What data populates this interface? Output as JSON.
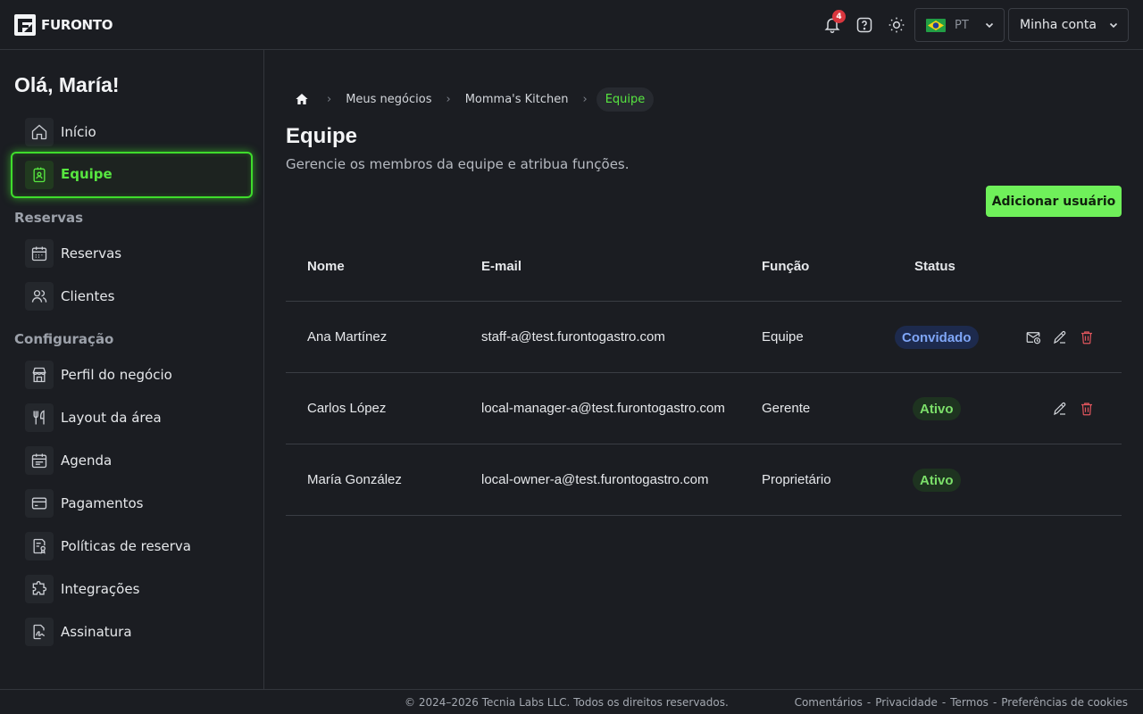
{
  "brand": {
    "name": "FURONTO"
  },
  "topbar": {
    "notifications_count": "4",
    "language": "PT",
    "account_label": "Minha conta"
  },
  "sidebar": {
    "greeting": "Olá, María!",
    "items_top": [
      {
        "label": "Início",
        "icon": "home-icon"
      },
      {
        "label": "Equipe",
        "icon": "badge-icon",
        "active": true
      }
    ],
    "section_reservas": "Reservas",
    "items_reservas": [
      {
        "label": "Reservas",
        "icon": "calendar-icon"
      },
      {
        "label": "Clientes",
        "icon": "users-icon"
      }
    ],
    "section_config": "Configuração",
    "items_config": [
      {
        "label": "Perfil do negócio",
        "icon": "store-icon"
      },
      {
        "label": "Layout da área",
        "icon": "utensils-icon"
      },
      {
        "label": "Agenda",
        "icon": "schedule-icon"
      },
      {
        "label": "Pagamentos",
        "icon": "card-icon"
      },
      {
        "label": "Políticas de reserva",
        "icon": "policy-icon"
      },
      {
        "label": "Integrações",
        "icon": "puzzle-icon"
      },
      {
        "label": "Assinatura",
        "icon": "signature-icon"
      }
    ]
  },
  "breadcrumb": {
    "items": [
      "Meus negócios",
      "Momma's Kitchen"
    ],
    "current": "Equipe"
  },
  "page": {
    "title": "Equipe",
    "subtitle": "Gerencie os membros da equipe e atribua funções.",
    "add_button": "Adicionar usuário"
  },
  "table": {
    "columns": [
      "Nome",
      "E-mail",
      "Função",
      "Status"
    ],
    "rows": [
      {
        "name": "Ana Martínez",
        "email": "staff-a@test.furontogastro.com",
        "role": "Equipe",
        "status": "Convidado",
        "actions": [
          "resend-invite",
          "edit",
          "delete"
        ]
      },
      {
        "name": "Carlos López",
        "email": "local-manager-a@test.furontogastro.com",
        "role": "Gerente",
        "status": "Ativo",
        "actions": [
          "edit",
          "delete"
        ]
      },
      {
        "name": "María González",
        "email": "local-owner-a@test.furontogastro.com",
        "role": "Proprietário",
        "status": "Ativo",
        "actions": []
      }
    ]
  },
  "footer": {
    "copyright": "© 2024–2026 Tecnia Labs LLC. Todos os direitos reservados.",
    "links": [
      "Comentários",
      "Privacidade",
      "Termos",
      "Preferências de cookies"
    ],
    "separator": "-"
  },
  "colors": {
    "accent": "#6ff05a",
    "active_green": "#3fdc2c",
    "invited_badge": "#7fa6f7",
    "delete_red": "#e0555d"
  }
}
